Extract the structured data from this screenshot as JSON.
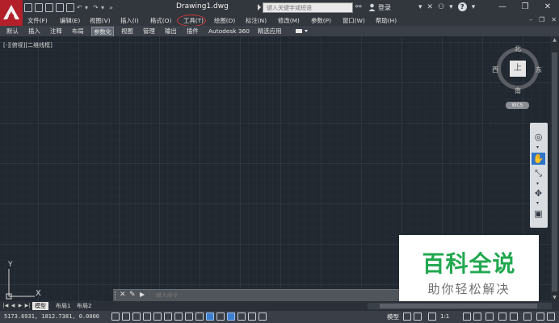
{
  "title_bar": {
    "document_title": "Drawing1.dwg",
    "search_placeholder": "键入关键字或短语",
    "login_label": "登录",
    "window_controls": [
      "—",
      "❐",
      "✕"
    ]
  },
  "menu_bar": {
    "items": [
      "文件(F)",
      "编辑(E)",
      "视图(V)",
      "插入(I)",
      "格式(O)",
      "工具(T)",
      "绘图(D)",
      "标注(N)",
      "修改(M)",
      "参数(P)",
      "窗口(W)",
      "帮助(H)"
    ],
    "highlighted_item": "工具(T)",
    "highlight_color": "#d03a3a"
  },
  "ribbon": {
    "tabs": [
      "默认",
      "插入",
      "注释",
      "布局",
      "参数化",
      "视图",
      "管理",
      "输出",
      "插件",
      "Autodesk 360",
      "精选应用"
    ],
    "active_tab": "参数化"
  },
  "viewport": {
    "label": "[-][俯视][二维线框]"
  },
  "view_cube": {
    "face": "上",
    "north": "北",
    "south": "南",
    "east": "东",
    "west": "西",
    "wcs_label": "WCS"
  },
  "ucs_icon": {
    "x_label": "X",
    "y_label": "Y"
  },
  "command_line": {
    "prompt_glyph": "▶",
    "placeholder": "键入命令"
  },
  "layout_tabs": {
    "tabs": [
      "模型",
      "布局1",
      "布局2"
    ],
    "active_tab": "模型"
  },
  "status_bar": {
    "coordinates": "5173.6931, 1812.7381, 0.0000",
    "model_label": "模型",
    "scale": "1:1"
  },
  "watermark": {
    "title": "百科全说",
    "subtitle": "助你轻松解决"
  },
  "colors": {
    "app_red": "#b3202a",
    "canvas_bg": "#212830",
    "watermark_green": "#21a84f",
    "nav_active_blue": "#2f75c9"
  }
}
